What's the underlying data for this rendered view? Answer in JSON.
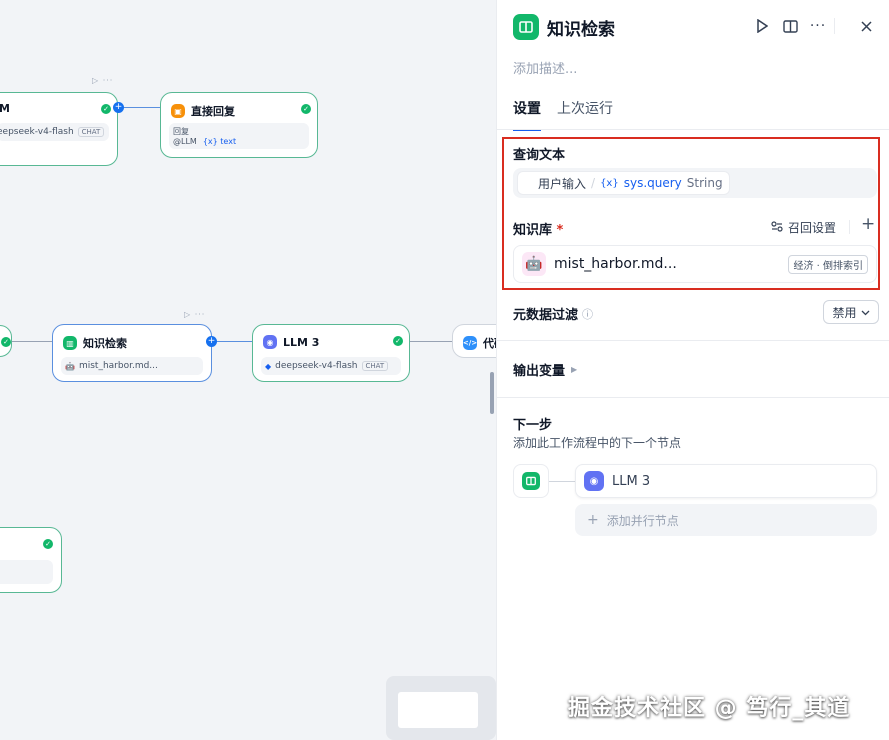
{
  "canvas": {
    "node_llm": {
      "title": "M",
      "model": "eepseek-v4-flash",
      "tag": "CHAT",
      "mini": "▷ ···"
    },
    "node_reply": {
      "title": "直接回复",
      "field": "回复",
      "ref": "@LLM",
      "var": "{x} text"
    },
    "node_kb": {
      "title": "知识检索",
      "file": "mist_harbor.md...",
      "mini": "▷ ···"
    },
    "node_llm3": {
      "title": "LLM 3",
      "model": "deepseek-v4-flash",
      "tag": "CHAT"
    },
    "node_code": {
      "title": "代码"
    }
  },
  "panel": {
    "title": "知识检索",
    "toolbar": {
      "run_icon": "play-icon",
      "view_icon": "book-icon",
      "more_icon": "more-icon",
      "close_icon": "close-icon"
    },
    "description_placeholder": "添加描述...",
    "tabs": [
      {
        "label": "设置",
        "active": true
      },
      {
        "label": "上次运行",
        "active": false
      }
    ],
    "query": {
      "label": "查询文本",
      "source": "用户输入",
      "sep": "/",
      "var_icon": "{x}",
      "var": "sys.query",
      "type": "String"
    },
    "kb": {
      "label": "知识库",
      "required": "*",
      "recall": "召回设置",
      "add": "+",
      "item_name": "mist_harbor.md...",
      "item_badge": "经济 · 倒排索引"
    },
    "metadata": {
      "label": "元数据过滤",
      "info": "ⓘ",
      "value": "禁用"
    },
    "output": {
      "label": "输出变量"
    },
    "next": {
      "title": "下一步",
      "desc": "添加此工作流程中的下一个节点",
      "node": "LLM 3",
      "parallel": "添加并行节点"
    }
  },
  "watermark": "掘金技术社区 @ 笃行_其道",
  "colors": {
    "accent": "#155eef",
    "success": "#12b76a",
    "highlight": "#d92d20"
  }
}
